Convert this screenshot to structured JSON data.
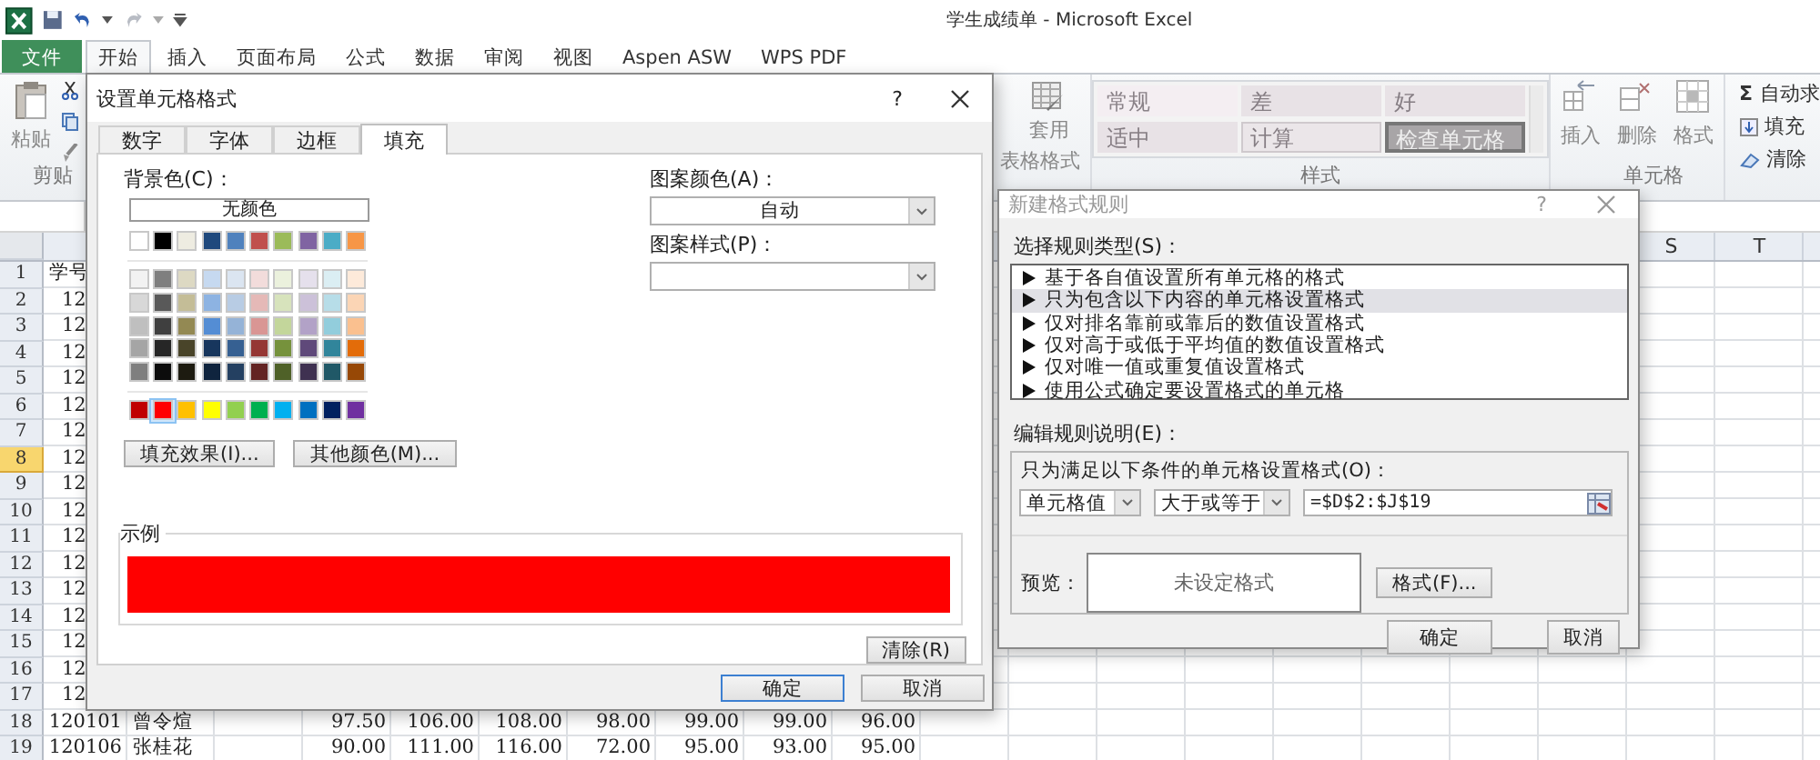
{
  "title_bar": {
    "title": "学生成绩单 - Microsoft Excel"
  },
  "ribbon_tabs": [
    {
      "label": "文件",
      "kind": "file",
      "selected": false
    },
    {
      "label": "开始",
      "kind": "tab",
      "selected": true
    },
    {
      "label": "插入",
      "kind": "tab",
      "selected": false
    },
    {
      "label": "页面布局",
      "kind": "tab",
      "selected": false
    },
    {
      "label": "公式",
      "kind": "tab",
      "selected": false
    },
    {
      "label": "数据",
      "kind": "tab",
      "selected": false
    },
    {
      "label": "审阅",
      "kind": "tab",
      "selected": false
    },
    {
      "label": "视图",
      "kind": "tab",
      "selected": false
    },
    {
      "label": "Aspen ASW",
      "kind": "tab",
      "selected": false
    },
    {
      "label": "WPS PDF",
      "kind": "tab",
      "selected": false
    }
  ],
  "ribbon": {
    "paste": "粘贴",
    "clipboard_group": "剪贴",
    "table_format": [
      "套用",
      "表格格式"
    ],
    "styles": [
      {
        "label": "常规",
        "kind": "normal"
      },
      {
        "label": "差",
        "kind": "bad"
      },
      {
        "label": "好",
        "kind": "good"
      },
      {
        "label": "适中",
        "kind": "neutral"
      },
      {
        "label": "计算",
        "kind": "calc"
      },
      {
        "label": "检查单元格",
        "kind": "check"
      }
    ],
    "styles_group": "样式",
    "cells": [
      "插入",
      "删除",
      "格式"
    ],
    "cells_group": "单元格",
    "editing": [
      {
        "label": "自动求",
        "kind": "sum",
        "symbol": "Σ"
      },
      {
        "label": "填充",
        "kind": "fill"
      },
      {
        "label": "清除",
        "kind": "clear"
      }
    ]
  },
  "sheet": {
    "column_headers": [
      "S",
      "T"
    ],
    "rows": [
      {
        "number": "1",
        "selected": false,
        "kind": "header",
        "id": "学号"
      },
      {
        "number": "2",
        "selected": false,
        "id": "12"
      },
      {
        "number": "3",
        "selected": false,
        "id": "12"
      },
      {
        "number": "4",
        "selected": false,
        "id": "12"
      },
      {
        "number": "5",
        "selected": false,
        "id": "12"
      },
      {
        "number": "6",
        "selected": false,
        "id": "12"
      },
      {
        "number": "7",
        "selected": false,
        "id": "12"
      },
      {
        "number": "8",
        "selected": true,
        "id": "12"
      },
      {
        "number": "9",
        "selected": false,
        "id": "12"
      },
      {
        "number": "10",
        "selected": false,
        "id": "12"
      },
      {
        "number": "11",
        "selected": false,
        "id": "12"
      },
      {
        "number": "12",
        "selected": false,
        "id": "12"
      },
      {
        "number": "13",
        "selected": false,
        "id": "12"
      },
      {
        "number": "14",
        "selected": false,
        "id": "12"
      },
      {
        "number": "15",
        "selected": false,
        "id": "12"
      },
      {
        "number": "16",
        "selected": false,
        "id": "12"
      },
      {
        "number": "17",
        "selected": false,
        "id": "12"
      },
      {
        "number": "18",
        "selected": false,
        "id": "120101",
        "name": "曾令煊",
        "scores": [
          "97.50",
          "106.00",
          "108.00",
          "98.00",
          "99.00",
          "99.00",
          "96.00"
        ]
      },
      {
        "number": "19",
        "selected": false,
        "id": "120106",
        "name": "张桂花",
        "scores": [
          "90.00",
          "111.00",
          "116.00",
          "72.00",
          "95.00",
          "93.00",
          "95.00"
        ]
      }
    ]
  },
  "format_dialog": {
    "title": "设置单元格格式",
    "help": "?",
    "tabs": [
      {
        "label": "数字",
        "selected": false
      },
      {
        "label": "字体",
        "selected": false
      },
      {
        "label": "边框",
        "selected": false
      },
      {
        "label": "填充",
        "selected": true
      }
    ],
    "background_label": "背景色(C)：",
    "no_color": "无颜色",
    "palette": [
      [
        {
          "color": "#ffffff",
          "selected": false
        },
        {
          "color": "#000000",
          "selected": false
        },
        {
          "color": "#eeece1",
          "selected": false
        },
        {
          "color": "#1f497d",
          "selected": false
        },
        {
          "color": "#4f81bd",
          "selected": false
        },
        {
          "color": "#c0504d",
          "selected": false
        },
        {
          "color": "#9bbb59",
          "selected": false
        },
        {
          "color": "#8064a2",
          "selected": false
        },
        {
          "color": "#4bacc6",
          "selected": false
        },
        {
          "color": "#f79646",
          "selected": false
        }
      ],
      [
        {
          "color": "#f2f2f2",
          "selected": false
        },
        {
          "color": "#7f7f7f",
          "selected": false
        },
        {
          "color": "#ddd9c3",
          "selected": false
        },
        {
          "color": "#c6d9f0",
          "selected": false
        },
        {
          "color": "#dbe5f1",
          "selected": false
        },
        {
          "color": "#f2dcdb",
          "selected": false
        },
        {
          "color": "#ebf1dd",
          "selected": false
        },
        {
          "color": "#e5e0ec",
          "selected": false
        },
        {
          "color": "#dbeef3",
          "selected": false
        },
        {
          "color": "#fdeada",
          "selected": false
        }
      ],
      [
        {
          "color": "#d8d8d8",
          "selected": false
        },
        {
          "color": "#595959",
          "selected": false
        },
        {
          "color": "#c4bd97",
          "selected": false
        },
        {
          "color": "#8db3e2",
          "selected": false
        },
        {
          "color": "#b8cce4",
          "selected": false
        },
        {
          "color": "#e5b9b7",
          "selected": false
        },
        {
          "color": "#d7e3bc",
          "selected": false
        },
        {
          "color": "#ccc1d9",
          "selected": false
        },
        {
          "color": "#b7dde8",
          "selected": false
        },
        {
          "color": "#fbd5b5",
          "selected": false
        }
      ],
      [
        {
          "color": "#bfbfbf",
          "selected": false
        },
        {
          "color": "#3f3f3f",
          "selected": false
        },
        {
          "color": "#938953",
          "selected": false
        },
        {
          "color": "#548dd4",
          "selected": false
        },
        {
          "color": "#95b3d7",
          "selected": false
        },
        {
          "color": "#d99694",
          "selected": false
        },
        {
          "color": "#c3d69b",
          "selected": false
        },
        {
          "color": "#b2a2c7",
          "selected": false
        },
        {
          "color": "#92cddc",
          "selected": false
        },
        {
          "color": "#fac08f",
          "selected": false
        }
      ],
      [
        {
          "color": "#a5a5a5",
          "selected": false
        },
        {
          "color": "#262626",
          "selected": false
        },
        {
          "color": "#494429",
          "selected": false
        },
        {
          "color": "#17365d",
          "selected": false
        },
        {
          "color": "#366092",
          "selected": false
        },
        {
          "color": "#953734",
          "selected": false
        },
        {
          "color": "#76923c",
          "selected": false
        },
        {
          "color": "#5f497a",
          "selected": false
        },
        {
          "color": "#31859b",
          "selected": false
        },
        {
          "color": "#e36c09",
          "selected": false
        }
      ],
      [
        {
          "color": "#7f7f7f",
          "selected": false
        },
        {
          "color": "#0c0c0c",
          "selected": false
        },
        {
          "color": "#1d1b10",
          "selected": false
        },
        {
          "color": "#0f243e",
          "selected": false
        },
        {
          "color": "#244061",
          "selected": false
        },
        {
          "color": "#632423",
          "selected": false
        },
        {
          "color": "#4f6128",
          "selected": false
        },
        {
          "color": "#3f3151",
          "selected": false
        },
        {
          "color": "#205867",
          "selected": false
        },
        {
          "color": "#974806",
          "selected": false
        }
      ],
      [
        {
          "color": "#c00000",
          "selected": false
        },
        {
          "color": "#ff0000",
          "selected": true
        },
        {
          "color": "#ffc000",
          "selected": false
        },
        {
          "color": "#ffff00",
          "selected": false
        },
        {
          "color": "#92d050",
          "selected": false
        },
        {
          "color": "#00b050",
          "selected": false
        },
        {
          "color": "#00b0f0",
          "selected": false
        },
        {
          "color": "#0070c0",
          "selected": false
        },
        {
          "color": "#002060",
          "selected": false
        },
        {
          "color": "#7030a0",
          "selected": false
        }
      ]
    ],
    "fill_effects": "填充效果(I)...",
    "more_colors": "其他颜色(M)...",
    "pattern_color_label": "图案颜色(A)：",
    "pattern_color": "自动",
    "pattern_style_label": "图案样式(P)：",
    "sample_label": "示例",
    "clear": "清除(R)",
    "ok": "确定",
    "cancel": "取消"
  },
  "rule_dialog": {
    "title": "新建格式规则",
    "help": "?",
    "type_label": "选择规则类型(S)：",
    "rule_types": [
      {
        "label": "基于各自值设置所有单元格的格式",
        "selected": false
      },
      {
        "label": "只为包含以下内容的单元格设置格式",
        "selected": true
      },
      {
        "label": "仅对排名靠前或靠后的数值设置格式",
        "selected": false
      },
      {
        "label": "仅对高于或低于平均值的数值设置格式",
        "selected": false
      },
      {
        "label": "仅对唯一值或重复值设置格式",
        "selected": false
      },
      {
        "label": "使用公式确定要设置格式的单元格",
        "selected": false
      }
    ],
    "edit_label": "编辑规则说明(E)：",
    "condition_label": "只为满足以下条件的单元格设置格式(O)：",
    "operand": "单元格值",
    "operator": "大于或等于",
    "formula": "=$D$2:$J$19",
    "preview_label": "预览：",
    "preview_text": "未设定格式",
    "format_button": "格式(F)...",
    "ok": "确定",
    "cancel": "取消"
  }
}
